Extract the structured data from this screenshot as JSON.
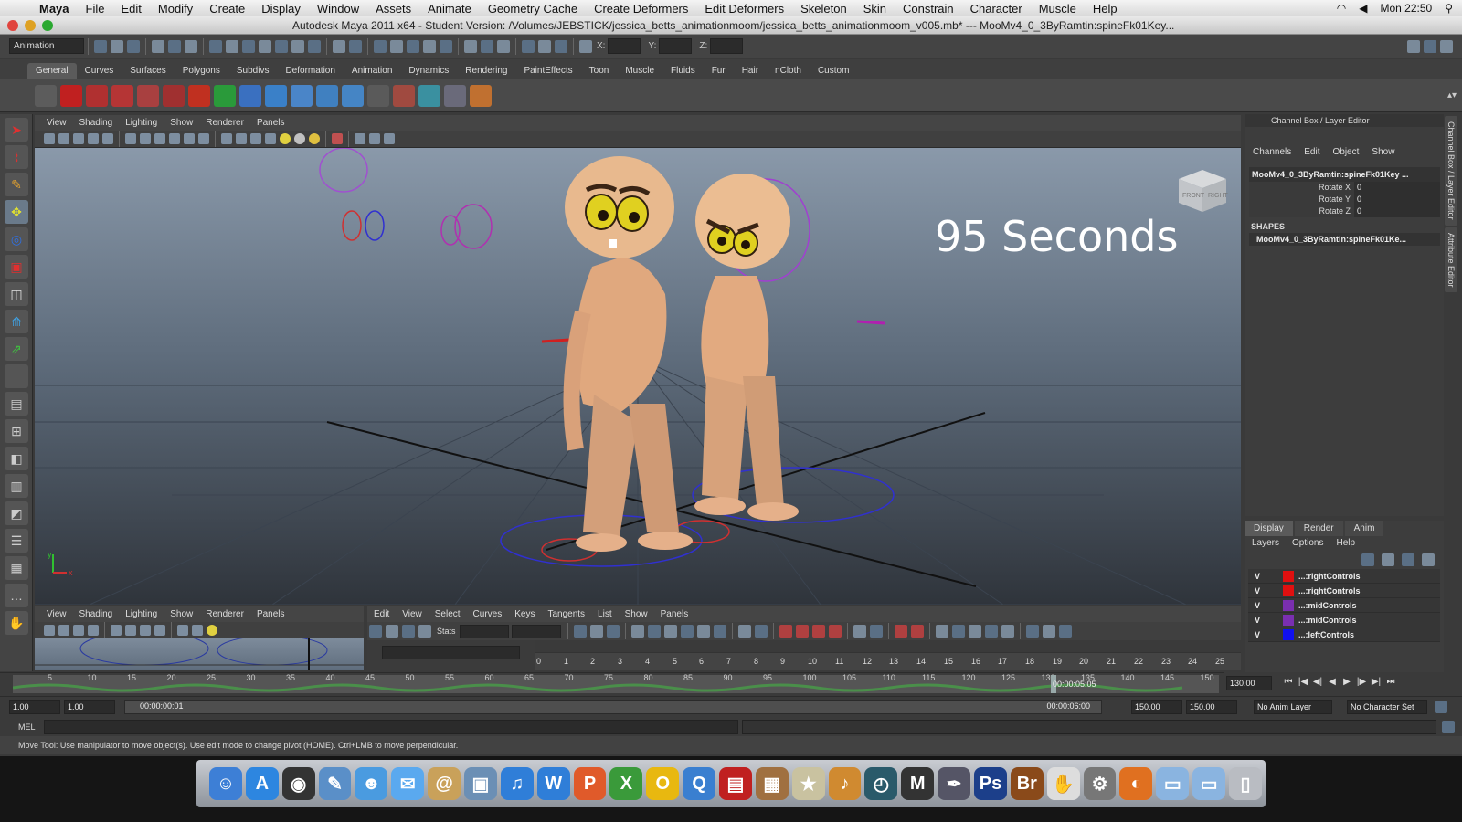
{
  "mac_menubar": {
    "app": "Maya",
    "items": [
      "File",
      "Edit",
      "Modify",
      "Create",
      "Display",
      "Window",
      "Assets",
      "Animate",
      "Geometry Cache",
      "Create Deformers",
      "Edit Deformers",
      "Skeleton",
      "Skin",
      "Constrain",
      "Character",
      "Muscle",
      "Help"
    ],
    "clock": "Mon 22:50"
  },
  "window": {
    "title": "Autodesk Maya 2011 x64 - Student Version: /Volumes/JEBSTICK/jessica_betts_animationmoom/jessica_betts_animationmoom_v005.mb*  ---  MooMv4_0_3ByRamtin:spineFk01Key..."
  },
  "statusline": {
    "menuset": "Animation",
    "x_label": "X:",
    "y_label": "Y:",
    "z_label": "Z:"
  },
  "shelf_tabs": [
    "General",
    "Curves",
    "Surfaces",
    "Polygons",
    "Subdivs",
    "Deformation",
    "Animation",
    "Dynamics",
    "Rendering",
    "PaintEffects",
    "Toon",
    "Muscle",
    "Fluids",
    "Fur",
    "Hair",
    "nCloth",
    "Custom"
  ],
  "viewport": {
    "menu": [
      "View",
      "Shading",
      "Lighting",
      "Show",
      "Renderer",
      "Panels"
    ],
    "overlay_text": "95 Seconds",
    "viewcube_front": "FRONT",
    "viewcube_right": "RIGHT",
    "axis_x": "x",
    "axis_y": "y"
  },
  "channel_box": {
    "header": "Channel Box / Layer Editor",
    "menu": [
      "Channels",
      "Edit",
      "Object",
      "Show"
    ],
    "object": "MooMv4_0_3ByRamtin:spineFk01Key ...",
    "attributes": [
      {
        "name": "Rotate X",
        "value": "0"
      },
      {
        "name": "Rotate Y",
        "value": "0"
      },
      {
        "name": "Rotate Z",
        "value": "0"
      }
    ],
    "shapes_label": "SHAPES",
    "shape": "MooMv4_0_3ByRamtin:spineFk01Ke..."
  },
  "side_tabs": [
    "Channel Box / Layer Editor",
    "Attribute Editor"
  ],
  "layer_editor": {
    "tabs": [
      "Display",
      "Render",
      "Anim"
    ],
    "menu": [
      "Layers",
      "Options",
      "Help"
    ],
    "layers": [
      {
        "vis": "V",
        "name": "...:rightControls",
        "color": "#e01010"
      },
      {
        "vis": "V",
        "name": "...:rightControls",
        "color": "#e01010"
      },
      {
        "vis": "V",
        "name": "...:midControls",
        "color": "#7a2fb0"
      },
      {
        "vis": "V",
        "name": "...:midControls",
        "color": "#7a2fb0"
      },
      {
        "vis": "V",
        "name": "...:leftControls",
        "color": "#1010f0"
      }
    ]
  },
  "mini_panel": {
    "menu": [
      "View",
      "Shading",
      "Lighting",
      "Show",
      "Renderer",
      "Panels"
    ]
  },
  "graph_editor": {
    "menu": [
      "Edit",
      "View",
      "Select",
      "Curves",
      "Keys",
      "Tangents",
      "List",
      "Show",
      "Panels"
    ],
    "stats_label": "Stats",
    "ruler_ticks": [
      "0",
      "1",
      "2",
      "3",
      "4",
      "5",
      "6",
      "7",
      "8",
      "9",
      "10",
      "11",
      "12",
      "13",
      "14",
      "15",
      "16",
      "17",
      "18",
      "19",
      "20",
      "21",
      "22",
      "23",
      "24",
      "25"
    ]
  },
  "time_slider": {
    "ticks": [
      "5",
      "10",
      "15",
      "20",
      "25",
      "30",
      "35",
      "40",
      "45",
      "50",
      "55",
      "60",
      "65",
      "70",
      "75",
      "80",
      "85",
      "90",
      "95",
      "100",
      "105",
      "110",
      "115",
      "120",
      "125",
      "130",
      "135",
      "140",
      "145",
      "150"
    ],
    "current_time": "00:00:05:05",
    "current_field": "130.00"
  },
  "range_slider": {
    "anim_start": "1.00",
    "playback_start": "1.00",
    "range_start_time": "00:00:00:01",
    "range_end_time": "00:00:06:00",
    "playback_end": "150.00",
    "anim_end": "150.00",
    "anim_layer": "No Anim Layer",
    "character_set": "No Character Set"
  },
  "command_line": {
    "label": "MEL"
  },
  "help_line": {
    "text": "Move Tool: Use manipulator to move object(s). Use edit mode to change pivot (HOME).  Ctrl+LMB to move perpendicular."
  },
  "dock": {
    "icons": [
      {
        "name": "finder-icon",
        "color": "#3d7fd6",
        "glyph": "☺"
      },
      {
        "name": "app-store-icon",
        "color": "#2d86e0",
        "glyph": "A"
      },
      {
        "name": "dashboard-icon",
        "color": "#333333",
        "glyph": "◉"
      },
      {
        "name": "preview-icon",
        "color": "#5a8fc8",
        "glyph": "✎"
      },
      {
        "name": "ichat-contacts-icon",
        "color": "#4a9be0",
        "glyph": "☻"
      },
      {
        "name": "ichat-icon",
        "color": "#5aa9ef",
        "glyph": "✉"
      },
      {
        "name": "address-book-icon",
        "color": "#c9a15a",
        "glyph": "@"
      },
      {
        "name": "iphoto-icon",
        "color": "#6b8fb5",
        "glyph": "▣"
      },
      {
        "name": "itunes-icon",
        "color": "#2f7ed8",
        "glyph": "♫"
      },
      {
        "name": "word-icon",
        "color": "#2f7ed8",
        "glyph": "W"
      },
      {
        "name": "powerpoint-icon",
        "color": "#e05a2a",
        "glyph": "P"
      },
      {
        "name": "excel-icon",
        "color": "#3a9a3a",
        "glyph": "X"
      },
      {
        "name": "outlook-icon",
        "color": "#e8b810",
        "glyph": "O"
      },
      {
        "name": "quicktime-icon",
        "color": "#3a7fd0",
        "glyph": "Q"
      },
      {
        "name": "photo-booth-icon",
        "color": "#c02020",
        "glyph": "▤"
      },
      {
        "name": "image-capture-icon",
        "color": "#a07040",
        "glyph": "▦"
      },
      {
        "name": "star-app-icon",
        "color": "#c9c2a0",
        "glyph": "★"
      },
      {
        "name": "garageband-icon",
        "color": "#d08a30",
        "glyph": "♪"
      },
      {
        "name": "time-machine-icon",
        "color": "#2a5a6a",
        "glyph": "◴"
      },
      {
        "name": "maya-icon",
        "color": "#333333",
        "glyph": "M"
      },
      {
        "name": "preview-pen-icon",
        "color": "#555566",
        "glyph": "✒"
      },
      {
        "name": "photoshop-icon",
        "color": "#1c3f8a",
        "glyph": "Ps"
      },
      {
        "name": "bridge-icon",
        "color": "#8a4a1a",
        "glyph": "Br"
      },
      {
        "name": "script-editor-icon",
        "color": "#dddddd",
        "glyph": "✋"
      },
      {
        "name": "system-preferences-icon",
        "color": "#777777",
        "glyph": "⚙"
      },
      {
        "name": "firefox-icon",
        "color": "#e07020",
        "glyph": "◐"
      },
      {
        "name": "applications-folder-icon",
        "color": "#8ab4e0",
        "glyph": "▭"
      },
      {
        "name": "documents-folder-icon",
        "color": "#8ab4e0",
        "glyph": "▭"
      },
      {
        "name": "trash-icon",
        "color": "#b9bcc2",
        "glyph": "▯"
      }
    ]
  }
}
